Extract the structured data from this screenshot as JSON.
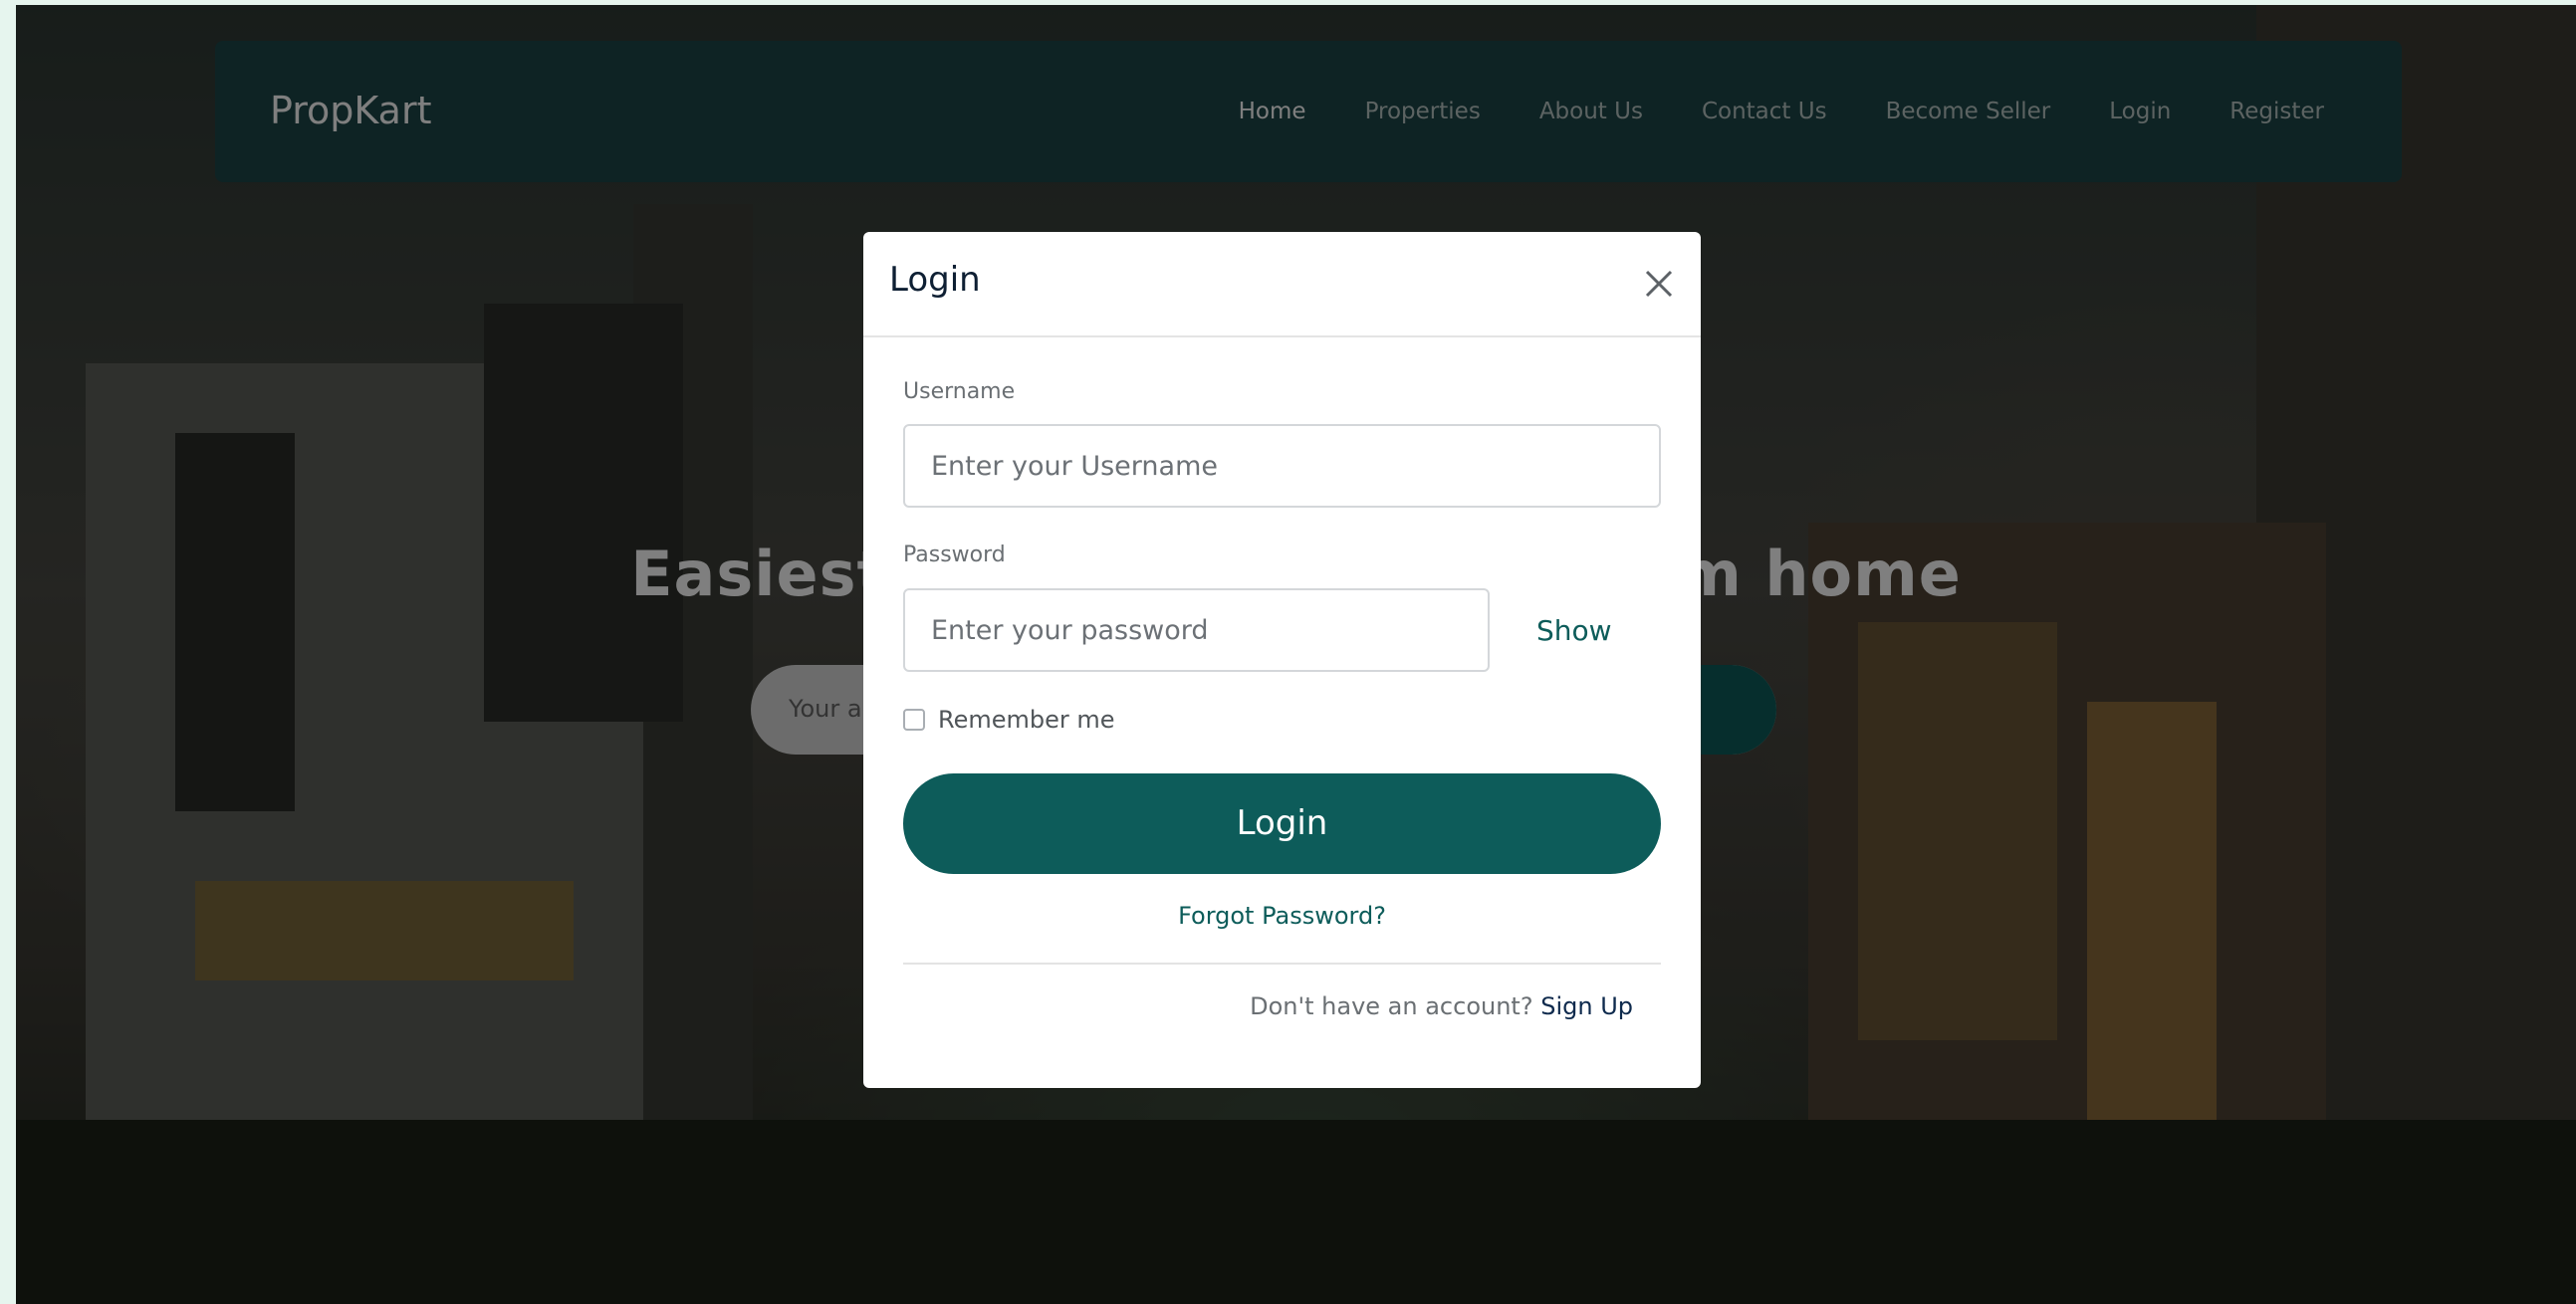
{
  "navbar": {
    "brand": "PropKart",
    "links": [
      "Home",
      "Properties",
      "About Us",
      "Contact Us",
      "Become Seller",
      "Login",
      "Register"
    ],
    "active_link": "Home"
  },
  "hero": {
    "title": "Easiest way to find your dream home",
    "search_placeholder": "Your address"
  },
  "login_modal": {
    "title": "Login",
    "username_label": "Username",
    "username_placeholder": "Enter your Username",
    "password_label": "Password",
    "password_placeholder": "Enter your password",
    "show_label": "Show",
    "remember_label": "Remember me",
    "remember_checked": false,
    "login_button": "Login",
    "forgot_link": "Forgot Password?",
    "signup_prompt": "Don't have an account?",
    "signup_link": "Sign Up"
  },
  "colors": {
    "primary": "#0d5c5a",
    "navbar_bg": "#1d4748",
    "modal_title": "#0e1f33",
    "page_bg": "#e6f5ee"
  },
  "icons": {
    "close": "close-icon"
  }
}
